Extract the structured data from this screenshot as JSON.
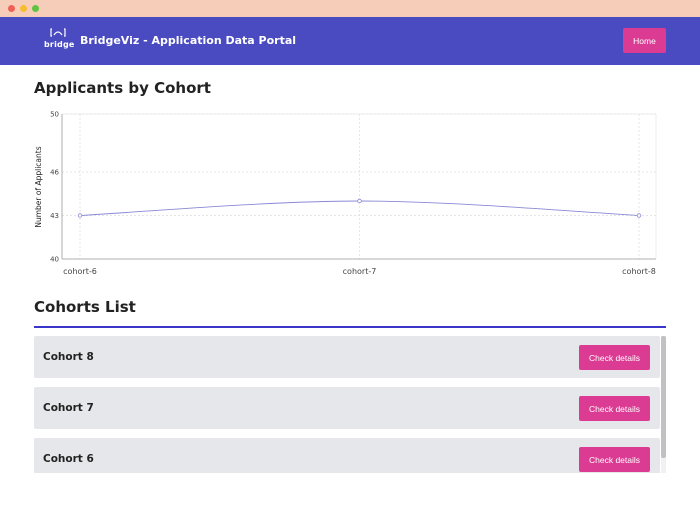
{
  "window": {
    "controls": [
      "close",
      "minimize",
      "maximize"
    ]
  },
  "navbar": {
    "logo_text": "bridge",
    "logo_icon": "bridge-logo-icon",
    "brand": "BridgeViz - Application Data Portal",
    "home_label": "Home",
    "color": "#4a4bc1"
  },
  "applicants_section": {
    "title": "Applicants by Cohort"
  },
  "chart_data": {
    "type": "line",
    "title": "",
    "xlabel": "",
    "ylabel": "Number of Applicants",
    "categories": [
      "cohort-6",
      "cohort-7",
      "cohort-8"
    ],
    "series": [
      {
        "values": [
          43,
          44,
          43
        ]
      }
    ],
    "ylim": [
      40,
      50
    ],
    "yticks": [
      40,
      43,
      46,
      50
    ],
    "grid": true,
    "line_color": "#8a89d6"
  },
  "cohorts_section": {
    "title": "Cohorts List",
    "items": [
      {
        "name": "Cohort 8",
        "action": "Check details"
      },
      {
        "name": "Cohort 7",
        "action": "Check details"
      },
      {
        "name": "Cohort 6",
        "action": "Check details"
      }
    ]
  },
  "accent_color": "#db3b92"
}
